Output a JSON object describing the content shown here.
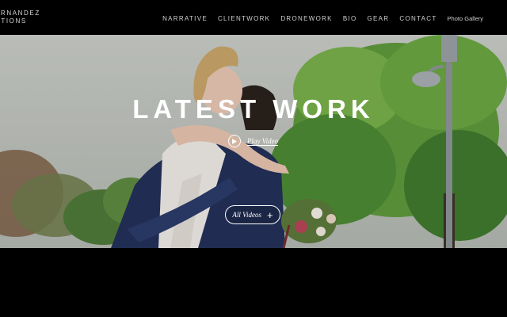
{
  "header": {
    "logo_line1": "ERNANDEZ",
    "logo_line2": "CTIONS",
    "nav": [
      "NARRATIVE",
      "CLIENTWORK",
      "DRONEWORK",
      "BIO",
      "GEAR",
      "CONTACT"
    ],
    "gallery": "Photo Gallery"
  },
  "hero": {
    "title": "LATEST WORK",
    "play_label": "Play Video",
    "all_videos_label": "All Videos",
    "all_videos_icon": "plus-icon"
  },
  "colors": {
    "background": "#000000",
    "text": "#ffffff"
  }
}
